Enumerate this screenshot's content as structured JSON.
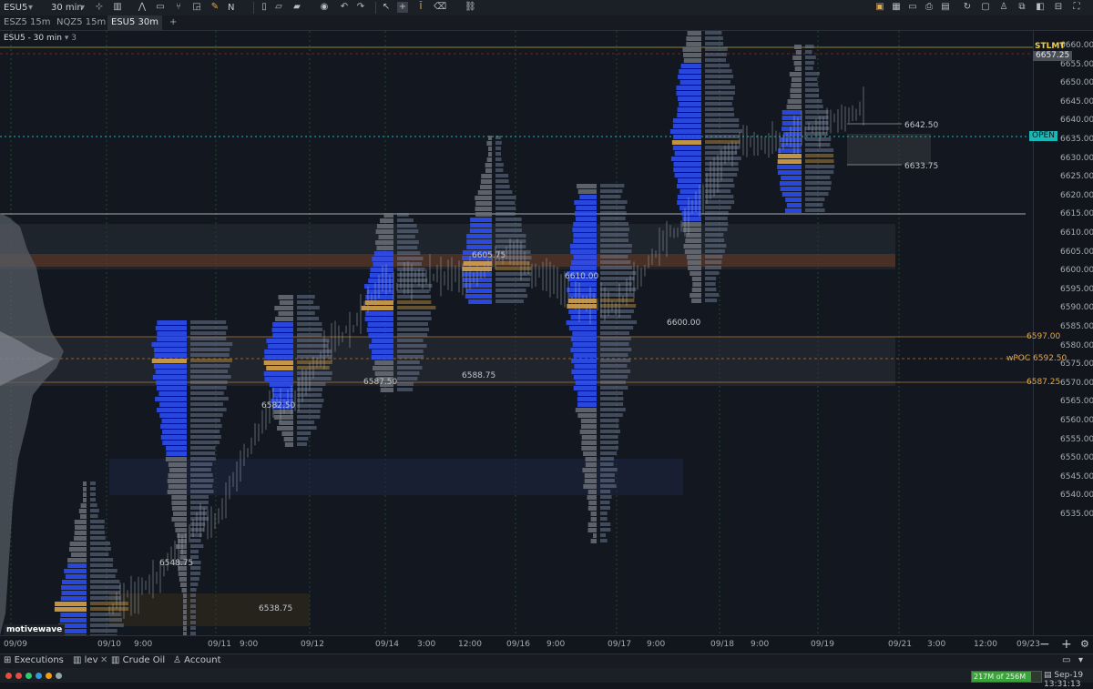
{
  "toolbar": {
    "symbol": "ESU5",
    "timeframe": "30 min",
    "left_icons": [
      "crosshair-icon",
      "chart-type-icon",
      "drawing-icon",
      "brush-icon",
      "text-icon",
      "new-doc-icon",
      "folder-icon",
      "save-icon",
      "camera-icon",
      "undo-icon",
      "redo-icon",
      "cursor-icon",
      "measure-icon",
      "magnet-icon"
    ],
    "right_icons": [
      "link-icon",
      "grid-icon",
      "window-icon",
      "print-icon",
      "layout-icon",
      "refresh-icon",
      "panel-icon",
      "user-icon",
      "popout-icon",
      "settings-icon"
    ]
  },
  "tabs": [
    {
      "label": "ESZ5 15m"
    },
    {
      "label": "NQZ5 15m"
    },
    {
      "label": "ESU5 30m"
    },
    {
      "label": "+"
    }
  ],
  "chart": {
    "title": "ESU5 - 30 min",
    "title_count": "3",
    "brand": "motivewave",
    "y_axis": [
      "6660.00",
      "6655.00",
      "6650.00",
      "6645.00",
      "6640.00",
      "6635.00",
      "6630.00",
      "6625.00",
      "6620.00",
      "6615.00",
      "6610.00",
      "6605.00",
      "6600.00",
      "6595.00",
      "6590.00",
      "6585.00",
      "6580.00",
      "6575.00",
      "6570.00",
      "6565.00",
      "6560.00",
      "6555.00",
      "6550.00",
      "6545.00",
      "6540.00",
      "6535.00"
    ],
    "x_axis": [
      "09/09",
      "09/10",
      "9:00",
      "09/11",
      "9:00",
      "09/12",
      "09/14",
      "3:00",
      "12:00",
      "09/16",
      "9:00",
      "09/17",
      "9:00",
      "09/18",
      "9:00",
      "09/19",
      "09/21",
      "3:00",
      "12:00",
      "09/23"
    ],
    "tags": {
      "stlmt_label": "STLMT",
      "last_price": "6657.25",
      "open_label": "OPEN",
      "vpoc_upper": "6597.00",
      "wpoc": "wPOC 6592.50",
      "vpoc_lower": "6587.25",
      "profile_hi": "6642.50",
      "profile_lo": "6633.75"
    },
    "annotations": [
      "6582.50",
      "6548.75",
      "6538.75",
      "6610.00",
      "6600.00",
      "6605.75",
      "6587.50",
      "6588.75"
    ],
    "colors": {
      "poc": "#e2a84c",
      "value_area": "#2f50ff",
      "open_line": "#1bb7b7",
      "stlmt": "#f0d042"
    }
  },
  "bottom_tabs": [
    {
      "label": "Executions",
      "icon": "executions-icon"
    },
    {
      "label": "lev",
      "icon": "chart-icon"
    },
    {
      "label": "Crude Oil",
      "icon": "chart-icon"
    },
    {
      "label": "Account",
      "icon": "account-icon"
    }
  ],
  "status": {
    "memory": "217M of 256M",
    "memory_fraction": 0.85,
    "datetime": "Sep-19 13:31:13",
    "dots": [
      "#e74c3c",
      "#e74c3c",
      "#2ecc71",
      "#3498db",
      "#f39c12",
      "#95a5a6"
    ]
  }
}
